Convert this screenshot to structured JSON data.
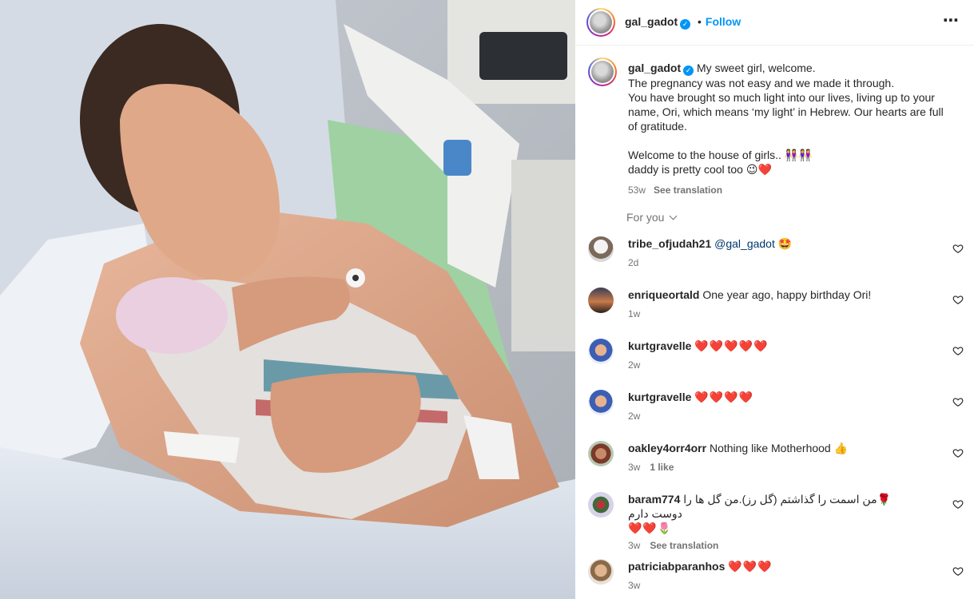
{
  "post": {
    "username": "gal_gadot",
    "follow_label": "Follow",
    "dot": "•",
    "more_icon": "⋯",
    "caption_lines": [
      "My sweet girl, welcome.",
      "The pregnancy was not easy and we made it through.",
      "You have brought so much light into our lives, living up to your name, Ori, which means ‘my light’ in Hebrew. Our hearts are full of gratitude.",
      "Welcome to the house of girls.. 👭👭",
      "daddy is pretty cool too 😉❤️"
    ],
    "time": "53w",
    "see_translation": "See translation"
  },
  "for_you": "For you",
  "comments": [
    {
      "user": "tribe_ofjudah21",
      "text": "@gal_gadot 🤩",
      "time": "2d",
      "likes": "",
      "translation": ""
    },
    {
      "user": "enriqueortald",
      "text": "One year ago, happy birthday Ori!",
      "time": "1w",
      "likes": "",
      "translation": ""
    },
    {
      "user": "kurtgravelle",
      "text": "❤️❤️❤️❤️❤️",
      "time": "2w",
      "likes": "",
      "translation": ""
    },
    {
      "user": "kurtgravelle",
      "text": "❤️❤️❤️❤️",
      "time": "2w",
      "likes": "",
      "translation": ""
    },
    {
      "user": "oakley4orr4orr",
      "text": "Nothing like Motherhood 👍",
      "time": "3w",
      "likes": "1 like",
      "translation": ""
    },
    {
      "user": "baram774",
      "text": "🌹من اسمت را گذاشتم (گل رز).من گل ها را دوست دارم",
      "text2": "❤️❤️🌷",
      "time": "3w",
      "likes": "",
      "translation": "See translation"
    },
    {
      "user": "patriciabparanhos",
      "text": "❤️❤️❤️",
      "time": "3w",
      "likes": "",
      "translation": ""
    }
  ]
}
